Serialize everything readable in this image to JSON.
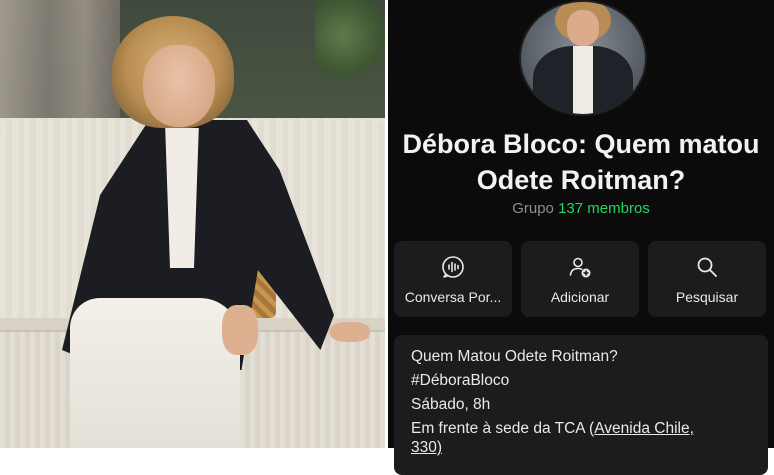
{
  "group": {
    "title_line1": "Débora Bloco: Quem matou",
    "title_line2": "Odete Roitman?",
    "type_label": "Grupo",
    "members_label": "137 membros"
  },
  "actions": [
    {
      "label": "Conversa Por...",
      "icon": "chat-waveform-icon"
    },
    {
      "label": "Adicionar",
      "icon": "add-person-icon"
    },
    {
      "label": "Pesquisar",
      "icon": "search-icon"
    }
  ],
  "description": {
    "line1": "Quem Matou Odete Roitman?",
    "line2": "#DéboraBloco",
    "line3": "Sábado, 8h",
    "line4_prefix": "Em frente à sede da TCA (",
    "line4_link": "Avenida Chile,",
    "line5": "330)"
  },
  "colors": {
    "background": "#0b0b0b",
    "card": "#1c1c1e",
    "accent_green": "#25d366",
    "muted_text": "#8e8e93"
  }
}
